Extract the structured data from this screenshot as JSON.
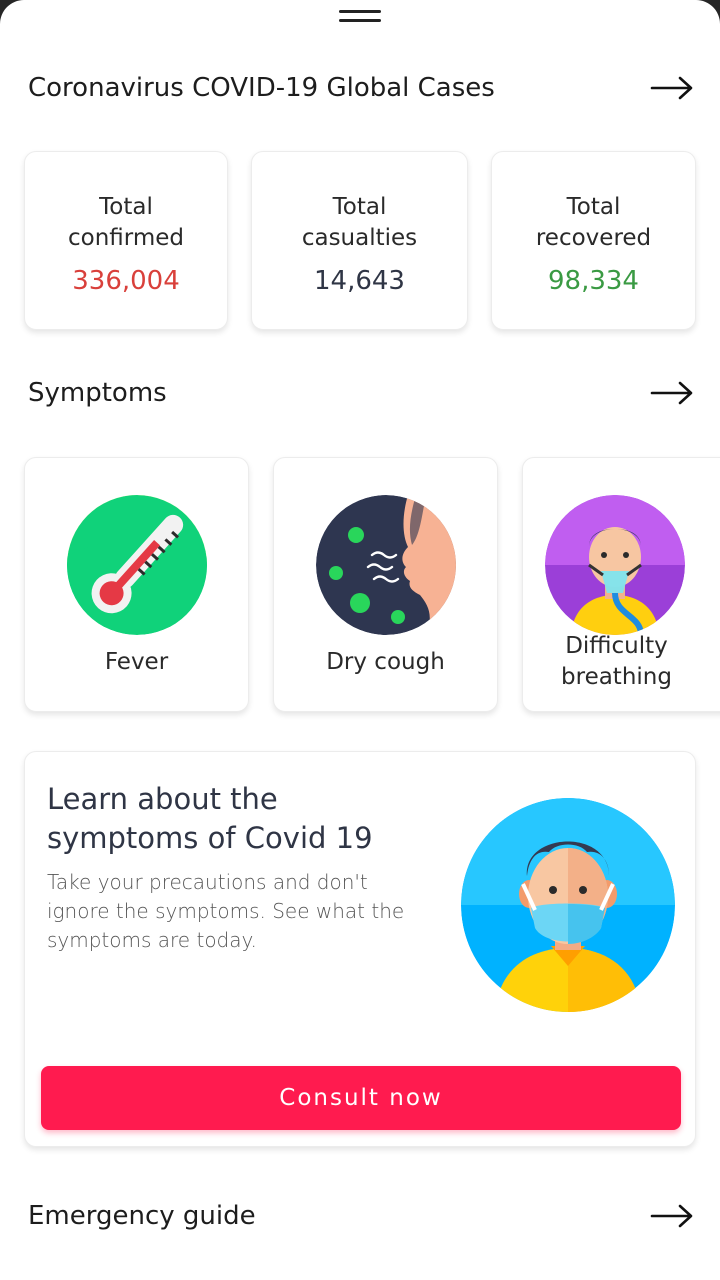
{
  "header": {
    "title": "Coronavirus COVID-19 Global Cases"
  },
  "stats": [
    {
      "label_line1": "Total",
      "label_line2": "confirmed",
      "value": "336,004",
      "color": "#d9403b"
    },
    {
      "label_line1": "Total",
      "label_line2": "casualties",
      "value": "14,643",
      "color": "#2f3545"
    },
    {
      "label_line1": "Total",
      "label_line2": "recovered",
      "value": "98,334",
      "color": "#3a9a43"
    }
  ],
  "symptoms": {
    "title": "Symptoms",
    "items": [
      {
        "name": "Fever",
        "icon": "thermometer-icon"
      },
      {
        "name": "Dry cough",
        "icon": "cough-icon"
      },
      {
        "name_line1": "Difficulty",
        "name_line2": "breathing",
        "icon": "oxygen-mask-icon"
      }
    ]
  },
  "learn": {
    "title": "Learn about the symptoms of Covid 19",
    "description": "Take your precautions and don't ignore the symptoms. See what the symptoms are today.",
    "button_label": "Consult now",
    "icon": "masked-person-icon"
  },
  "emergency": {
    "title": "Emergency guide"
  },
  "colors": {
    "accent": "#ff1b4f",
    "confirmed": "#d9403b",
    "recovered": "#3a9a43"
  }
}
